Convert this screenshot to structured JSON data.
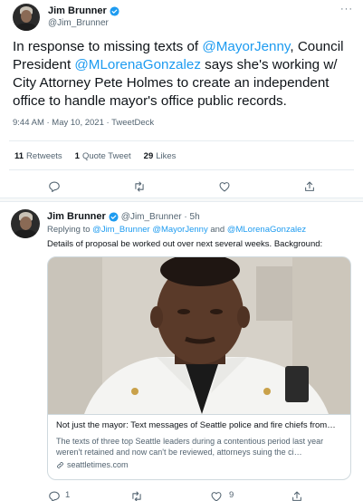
{
  "main_tweet": {
    "author_name": "Jim Brunner",
    "author_handle": "@Jim_Brunner",
    "text_parts": [
      {
        "t": "In response to missing texts of ",
        "link": false
      },
      {
        "t": "@MayorJenny",
        "link": true
      },
      {
        "t": ", Council President ",
        "link": false
      },
      {
        "t": "@MLorenaGonzalez",
        "link": true
      },
      {
        "t": " says she's working w/ City Attorney Pete Holmes to create an independent office to handle mayor's office public records.",
        "link": false
      }
    ],
    "timestamp": "9:44 AM · May 10, 2021 · TweetDeck",
    "retweets_count": "11",
    "retweets_label": "Retweets",
    "quote_count": "1",
    "quote_label": "Quote Tweet",
    "likes_count": "29",
    "likes_label": "Likes"
  },
  "reply_tweet": {
    "author_name": "Jim Brunner",
    "author_handle": "@Jim_Brunner · 5h",
    "replying_label": "Replying to",
    "replying_to_1": "@Jim_Brunner",
    "replying_to_2": "@MayorJenny",
    "replying_and": "and",
    "replying_to_3": "@MLorenaGonzalez",
    "text": "Details of proposal be worked out over next several weeks. Background:",
    "card": {
      "title": "Not just the mayor: Text messages of Seattle police and fire chiefs from…",
      "description": "The texts of three top Seattle leaders during a contentious period last year weren't retained and now can't be reviewed, attorneys suing the ci…",
      "domain": "seattletimes.com"
    },
    "reply_count": "1",
    "like_count": "9"
  },
  "icons": [
    "verified-icon",
    "more-icon",
    "reply-icon",
    "retweet-icon",
    "like-icon",
    "share-icon",
    "link-icon"
  ],
  "colors": {
    "link": "#1d9bf0",
    "muted": "#536471",
    "text": "#0f1419"
  }
}
